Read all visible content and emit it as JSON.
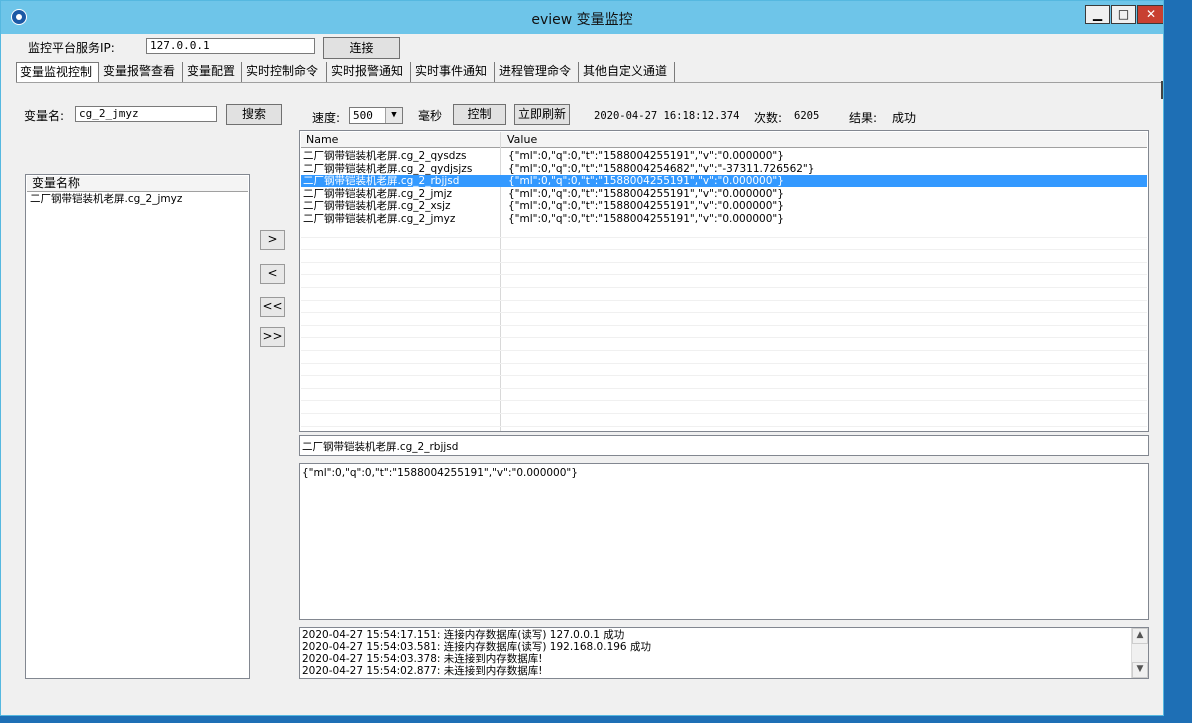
{
  "window": {
    "title": "eview 变量监控",
    "min": "▁",
    "max": "□",
    "close": "✕"
  },
  "server": {
    "label": "监控平台服务IP:",
    "ip": "127.0.0.1",
    "connect": "连接"
  },
  "tabs": [
    "变量监视控制",
    "变量报警查看",
    "变量配置",
    "实时控制命令",
    "实时报警通知",
    "实时事件通知",
    "进程管理命令",
    "其他自定义通道"
  ],
  "search": {
    "label": "变量名:",
    "value": "cg_2_jmyz",
    "button": "搜索"
  },
  "speed": {
    "label": "速度:",
    "value": "500",
    "unit": "毫秒",
    "control": "控制",
    "refresh": "立即刷新"
  },
  "status": {
    "time": "2020-04-27 16:18:12.374",
    "count_label": "次数:",
    "count": "6205",
    "result_label": "结果:",
    "result": "成功"
  },
  "left_list": {
    "header": "变量名称",
    "items": [
      "二厂钢带铠装机老屏.cg_2_jmyz"
    ]
  },
  "move_buttons": [
    ">",
    "<",
    "<<",
    ">>"
  ],
  "var_table": {
    "columns": [
      "Name",
      "Value"
    ],
    "rows": [
      {
        "name": "二厂钢带铠装机老屏.cg_2_qysdzs",
        "value": "{\"ml\":0,\"q\":0,\"t\":\"1588004255191\",\"v\":\"0.000000\"}"
      },
      {
        "name": "二厂钢带铠装机老屏.cg_2_qydjsjzs",
        "value": "{\"ml\":0,\"q\":0,\"t\":\"1588004254682\",\"v\":\"-37311.726562\"}"
      },
      {
        "name": "二厂钢带铠装机老屏.cg_2_rbjjsd",
        "value": "{\"ml\":0,\"q\":0,\"t\":\"1588004255191\",\"v\":\"0.000000\"}"
      },
      {
        "name": "二厂钢带铠装机老屏.cg_2_jmjz",
        "value": "{\"ml\":0,\"q\":0,\"t\":\"1588004255191\",\"v\":\"0.000000\"}"
      },
      {
        "name": "二厂钢带铠装机老屏.cg_2_xsjz",
        "value": "{\"ml\":0,\"q\":0,\"t\":\"1588004255191\",\"v\":\"0.000000\"}"
      },
      {
        "name": "二厂钢带铠装机老屏.cg_2_jmyz",
        "value": "{\"ml\":0,\"q\":0,\"t\":\"1588004255191\",\"v\":\"0.000000\"}"
      }
    ]
  },
  "selected_name": "二厂钢带铠装机老屏.cg_2_rbjjsd",
  "selected_value": "{\"ml\":0,\"q\":0,\"t\":\"1588004255191\",\"v\":\"0.000000\"}",
  "log": [
    "2020-04-27 15:54:17.151: 连接内存数据库(读写) 127.0.0.1 成功",
    "2020-04-27 15:54:03.581: 连接内存数据库(读写) 192.168.0.196 成功",
    "2020-04-27 15:54:03.378: 未连接到内存数据库!",
    "2020-04-27 15:54:02.877: 未连接到内存数据库!"
  ],
  "log_scroll": {
    "up": "▲",
    "down": "▼"
  }
}
